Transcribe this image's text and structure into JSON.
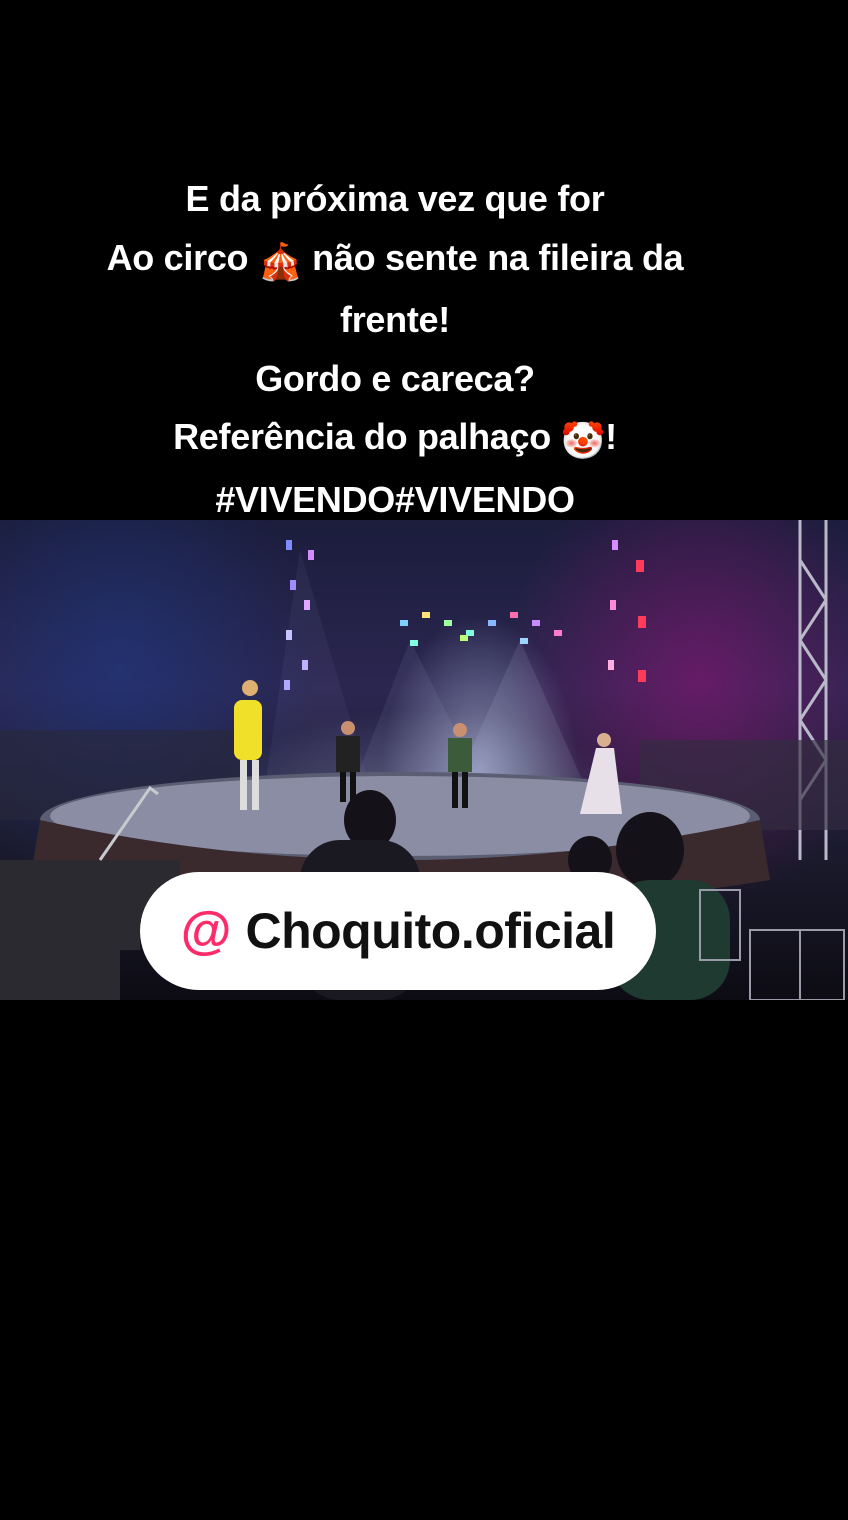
{
  "caption": {
    "lines": [
      "E da próxima vez que for",
      "Ao circo",
      "não sente na fileira da",
      "frente!",
      "Gordo e careca?",
      "Referência do palhaço",
      "!",
      "#VIVENDO#VIVENDO"
    ],
    "emoji_circus": "🎪",
    "emoji_clown": "🤡"
  },
  "video": {
    "icon": "circus-stage-video-frame"
  },
  "handle": {
    "at": "@",
    "name": "Choquito.oficial"
  }
}
